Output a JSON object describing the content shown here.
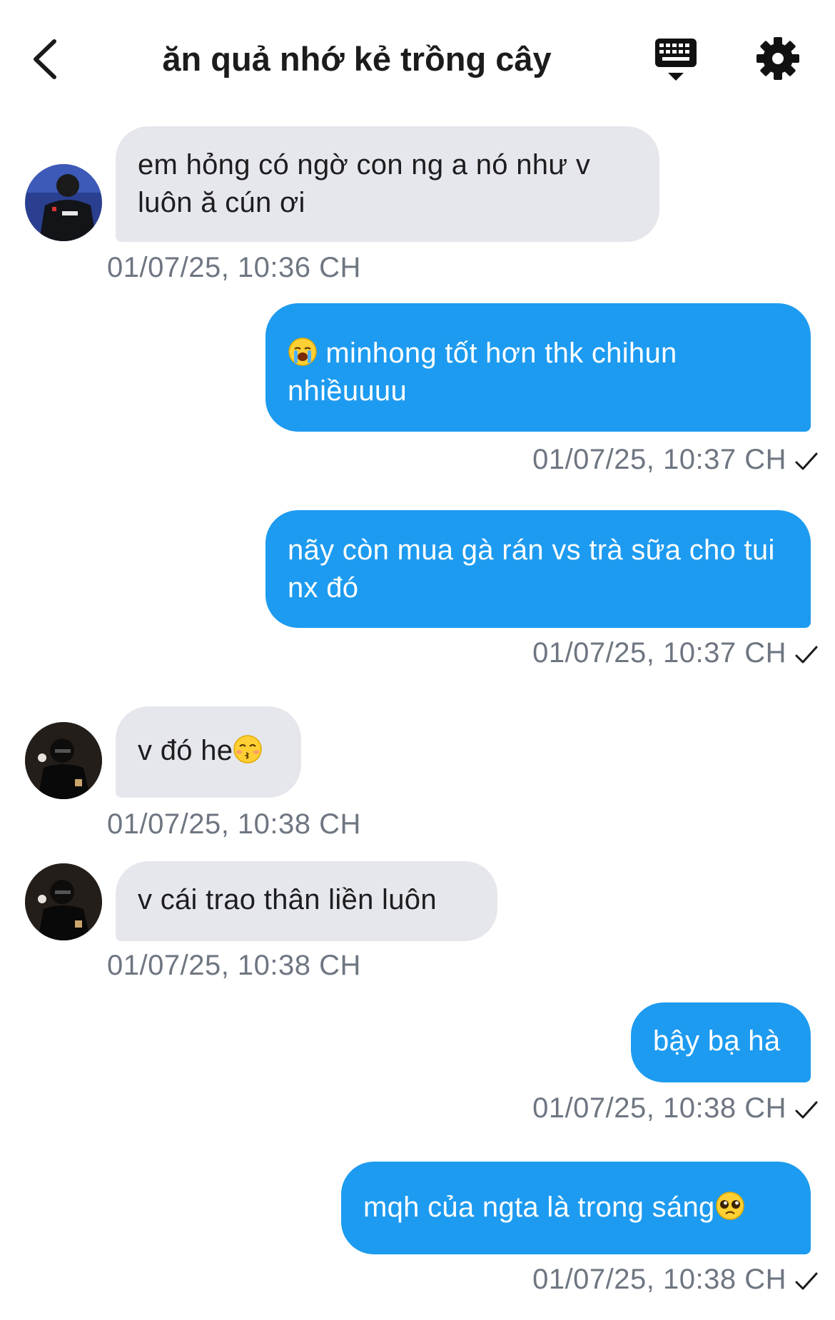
{
  "header": {
    "title": "ăn quả nhớ kẻ trồng cây"
  },
  "messages": [
    {
      "direction": "in",
      "text": "em hỏng có ngờ con ng a nó như v luôn ă cún ơi",
      "time": "01/07/25, 10:36 CH"
    },
    {
      "direction": "out",
      "emoji": "loudly-crying-face",
      "text": "minhong tốt hơn thk chihun nhiềuuuu",
      "time": "01/07/25, 10:37 CH"
    },
    {
      "direction": "out",
      "text": "nãy còn mua gà rán vs trà sữa cho tui nx đó",
      "time": "01/07/25, 10:37 CH"
    },
    {
      "direction": "in",
      "text": "v đó he",
      "emoji": "kissing-face",
      "time": "01/07/25, 10:38 CH"
    },
    {
      "direction": "in",
      "text": "v cái trao thân liền luôn",
      "time": "01/07/25, 10:38 CH"
    },
    {
      "direction": "out",
      "text": "bậy bạ hà",
      "time": "01/07/25, 10:38 CH"
    },
    {
      "direction": "out",
      "text": "mqh của ngta là trong sáng",
      "emoji": "pleading-face",
      "time": "01/07/25, 10:38 CH"
    }
  ],
  "colors": {
    "outgoing_bubble": "#1d9bf0",
    "incoming_bubble": "#e6e7ec",
    "timestamp": "#6e7681"
  }
}
